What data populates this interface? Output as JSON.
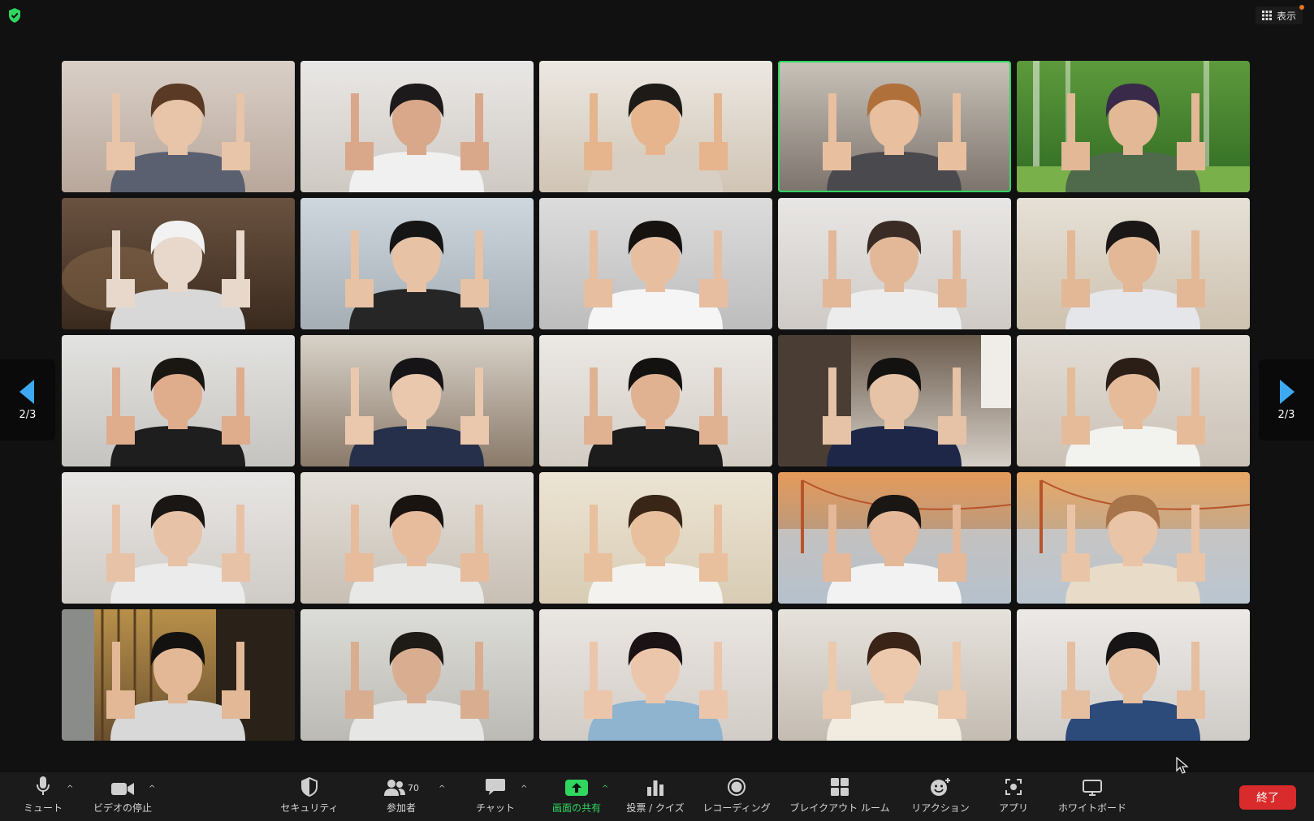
{
  "meeting": {
    "view_label": "表示",
    "page_indicator_left": "2/3",
    "page_indicator_right": "2/3",
    "active_speaker_index": 3,
    "colors": {
      "active": "#2fd660",
      "end": "#d92b2b",
      "nav_arrow": "#3da9f5"
    }
  },
  "tiles": [
    {
      "name": "participant-tile-1",
      "bg1": "#d9cfc7",
      "bg2": "#b9a79b",
      "skin": "#e8c4a8",
      "hair": "#5a3a24",
      "shirt": "#5a6070",
      "bg": "room"
    },
    {
      "name": "participant-tile-2",
      "bg1": "#e9e7e5",
      "bg2": "#cfc9c3",
      "skin": "#d9a88a",
      "hair": "#1c1a1a",
      "shirt": "#f0f0f0",
      "bg": "room"
    },
    {
      "name": "participant-tile-3",
      "bg1": "#ece8e2",
      "bg2": "#d0c4b4",
      "skin": "#e6b58e",
      "hair": "#1e1a18",
      "shirt": "#d8cfc4",
      "bg": "room"
    },
    {
      "name": "participant-tile-4",
      "bg1": "#c9c2b9",
      "bg2": "#7c746c",
      "skin": "#e8c0a0",
      "hair": "#b0703a",
      "shirt": "#4a4a4e",
      "bg": "room"
    },
    {
      "name": "participant-tile-5",
      "bg1": "#5d9a3c",
      "bg2": "#2f6a22",
      "skin": "#e2b896",
      "hair": "#3a2a4a",
      "shirt": "#4f6a4a",
      "bg": "forest"
    },
    {
      "name": "participant-tile-6",
      "bg1": "#6a5240",
      "bg2": "#3a2a1e",
      "skin": "#e8d8cc",
      "hair": "#f2f2f2",
      "shirt": "#d8d8d8",
      "bg": "blur"
    },
    {
      "name": "participant-tile-7",
      "bg1": "#cdd7dd",
      "bg2": "#a4aeb4",
      "skin": "#e8c2a4",
      "hair": "#151515",
      "shirt": "#262626",
      "bg": "room"
    },
    {
      "name": "participant-tile-8",
      "bg1": "#dcdcdc",
      "bg2": "#bdbdbd",
      "skin": "#e7bea0",
      "hair": "#151210",
      "shirt": "#f5f5f5",
      "bg": "room"
    },
    {
      "name": "participant-tile-9",
      "bg1": "#e8e6e4",
      "bg2": "#cfcac6",
      "skin": "#e2b898",
      "hair": "#3a2c24",
      "shirt": "#ececec",
      "bg": "room"
    },
    {
      "name": "participant-tile-10",
      "bg1": "#e6e0d6",
      "bg2": "#cec2b0",
      "skin": "#e3b896",
      "hair": "#1a1716",
      "shirt": "#e4e6ea",
      "bg": "room"
    },
    {
      "name": "participant-tile-11",
      "bg1": "#e2e2e0",
      "bg2": "#c6c4c0",
      "skin": "#dfac8c",
      "hair": "#1a1612",
      "shirt": "#1e1e1e",
      "bg": "room"
    },
    {
      "name": "participant-tile-12",
      "bg1": "#d8d2c8",
      "bg2": "#8a7a6a",
      "skin": "#eac8ae",
      "hair": "#161416",
      "shirt": "#26304a",
      "bg": "room"
    },
    {
      "name": "participant-tile-13",
      "bg1": "#ece8e4",
      "bg2": "#d2ccc4",
      "skin": "#e0b292",
      "hair": "#141210",
      "shirt": "#1c1c1c",
      "bg": "room"
    },
    {
      "name": "participant-tile-14",
      "bg1": "#6a5a4c",
      "bg2": "#d6d0c8",
      "skin": "#e6c2a6",
      "hair": "#141210",
      "shirt": "#1e2748",
      "bg": "curtain"
    },
    {
      "name": "participant-tile-15",
      "bg1": "#e2ddd6",
      "bg2": "#cbc2b6",
      "skin": "#e6bb9a",
      "hair": "#2a1e16",
      "shirt": "#f2f2ee",
      "bg": "room"
    },
    {
      "name": "participant-tile-16",
      "bg1": "#e8e6e4",
      "bg2": "#cfcbc6",
      "skin": "#e8c2a6",
      "hair": "#1a1614",
      "shirt": "#ebebeb",
      "bg": "room"
    },
    {
      "name": "participant-tile-17",
      "bg1": "#e4e0da",
      "bg2": "#c8bfb4",
      "skin": "#e6bc9c",
      "hair": "#1a1410",
      "shirt": "#e8e8e6",
      "bg": "room"
    },
    {
      "name": "participant-tile-18",
      "bg1": "#ece4d4",
      "bg2": "#d8ccb4",
      "skin": "#e8c09e",
      "hair": "#3a2616",
      "shirt": "#f4f2ee",
      "bg": "room"
    },
    {
      "name": "participant-tile-19",
      "bg1": "#e59a5a",
      "bg2": "#8a9aa8",
      "skin": "#e4b898",
      "hair": "#1a1614",
      "shirt": "#f2f2f2",
      "bg": "sunset"
    },
    {
      "name": "participant-tile-20",
      "bg1": "#e8a866",
      "bg2": "#9aa8b6",
      "skin": "#eac4a6",
      "hair": "#a8744a",
      "shirt": "#e8dcc8",
      "bg": "sunset"
    },
    {
      "name": "participant-tile-21",
      "bg1": "#b8904a",
      "bg2": "#6a5030",
      "skin": "#e2b896",
      "hair": "#141210",
      "shirt": "#d8d8d8",
      "bg": "wood"
    },
    {
      "name": "participant-tile-22",
      "bg1": "#dcdcd8",
      "bg2": "#bcbab4",
      "skin": "#d9ae90",
      "hair": "#1e1a16",
      "shirt": "#e6e6e4",
      "bg": "room"
    },
    {
      "name": "participant-tile-23",
      "bg1": "#eae6e2",
      "bg2": "#d2ccc6",
      "skin": "#ecc6aa",
      "hair": "#1a1214",
      "shirt": "#8fb4d0",
      "bg": "room"
    },
    {
      "name": "participant-tile-24",
      "bg1": "#e6e2dc",
      "bg2": "#c4bcb2",
      "skin": "#ecc8ac",
      "hair": "#3a2418",
      "shirt": "#f2ece0",
      "bg": "room"
    },
    {
      "name": "participant-tile-25",
      "bg1": "#ece9e6",
      "bg2": "#cfccc8",
      "skin": "#e6bea0",
      "hair": "#161414",
      "shirt": "#2c4a7a",
      "bg": "room"
    }
  ],
  "toolbar": {
    "mute_label": "ミュート",
    "video_label": "ビデオの停止",
    "security_label": "セキュリティ",
    "participants_label": "参加者",
    "participants_count": "70",
    "chat_label": "チャット",
    "share_label": "画面の共有",
    "polls_label": "投票 / クイズ",
    "record_label": "レコーディング",
    "breakout_label": "ブレイクアウト ルーム",
    "reactions_label": "リアクション",
    "apps_label": "アプリ",
    "whiteboard_label": "ホワイトボード",
    "end_label": "終了"
  }
}
